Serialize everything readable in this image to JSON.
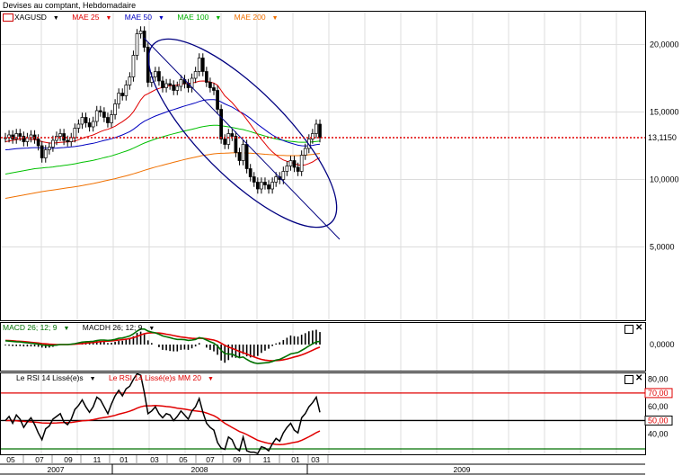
{
  "window": {
    "title": "Devises au comptant, Hebdomadaire"
  },
  "main_legend": {
    "symbol": "XAGUSD",
    "items": [
      {
        "label": "MAE 25",
        "color": "#e00000"
      },
      {
        "label": "MAE 50",
        "color": "#0000c0"
      },
      {
        "label": "MAE 100",
        "color": "#00b000"
      },
      {
        "label": "MAE 200",
        "color": "#f07000"
      }
    ]
  },
  "price_axis": {
    "ticks": [
      "20,0000",
      "15,0000",
      "10,0000",
      "5,0000"
    ],
    "last_price": "13,1150"
  },
  "macd_legend": {
    "items": [
      {
        "label": "MACD 26; 12; 9",
        "color": "#007000"
      },
      {
        "label": "MACDH 26; 12; 9",
        "color": "#000000"
      }
    ]
  },
  "macd_axis": {
    "ticks": [
      "0,0000"
    ]
  },
  "rsi_legend": {
    "items": [
      {
        "label": "Le RSI 14 Lissé(e)s",
        "color": "#000000"
      },
      {
        "label": "Le RSI 14 Lissé(e)s MM 20",
        "color": "#e00000"
      }
    ]
  },
  "rsi_axis": {
    "ticks": [
      "80,00",
      "70,00",
      "60,00",
      "50,00",
      "40,00"
    ]
  },
  "time_axis": {
    "months": [
      "05",
      "07",
      "09",
      "11",
      "01",
      "03",
      "05",
      "07",
      "09",
      "11",
      "01",
      "03"
    ],
    "years": [
      "2007",
      "2008",
      "2009"
    ]
  },
  "chart_data": {
    "type": "candlestick",
    "title": "XAGUSD",
    "ylim": [
      2.5,
      22.5
    ],
    "price_series": {
      "name": "XAGUSD",
      "close": [
        13.1,
        13.3,
        13.0,
        13.4,
        13.2,
        12.8,
        13.1,
        13.3,
        13.0,
        12.5,
        11.6,
        12.2,
        12.4,
        12.9,
        13.2,
        13.4,
        12.9,
        12.8,
        13.1,
        13.8,
        14.1,
        14.6,
        14.2,
        13.9,
        14.3,
        15.1,
        15.0,
        14.6,
        14.2,
        14.8,
        15.6,
        16.4,
        16.2,
        17.0,
        17.6,
        19.2,
        20.8,
        21.0,
        19.8,
        17.2,
        17.6,
        18.0,
        17.3,
        16.8,
        17.1,
        17.0,
        16.6,
        16.9,
        17.4,
        17.1,
        16.8,
        17.5,
        18.0,
        19.0,
        18.0,
        17.2,
        16.8,
        16.6,
        15.2,
        13.0,
        12.6,
        13.4,
        13.2,
        12.0,
        11.4,
        12.6,
        10.8,
        10.2,
        9.8,
        9.3,
        9.8,
        9.6,
        9.3,
        9.8,
        10.2,
        10.0,
        10.6,
        11.0,
        11.4,
        10.9,
        10.6,
        11.8,
        12.3,
        13.0,
        13.4,
        14.1,
        13.1
      ],
      "ma25": [
        12.8,
        12.85,
        12.9,
        12.95,
        13.0,
        13.0,
        12.98,
        12.97,
        12.95,
        12.9,
        12.8,
        12.75,
        12.7,
        12.7,
        12.72,
        12.75,
        12.77,
        12.78,
        12.8,
        12.85,
        12.95,
        13.05,
        13.15,
        13.22,
        13.3,
        13.42,
        13.55,
        13.65,
        13.72,
        13.82,
        13.95,
        14.12,
        14.28,
        14.48,
        14.7,
        15.02,
        15.45,
        15.9,
        16.22,
        16.35,
        16.5,
        16.65,
        16.75,
        16.82,
        16.9,
        16.95,
        16.97,
        17.0,
        17.05,
        17.1,
        17.12,
        17.15,
        17.2,
        17.28,
        17.3,
        17.28,
        17.22,
        17.15,
        16.98,
        16.6,
        16.2,
        15.95,
        15.7,
        15.38,
        15.05,
        14.8,
        14.45,
        14.08,
        13.7,
        13.32,
        12.98,
        12.65,
        12.32,
        12.05,
        11.82,
        11.6,
        11.45,
        11.35,
        11.28,
        11.18,
        11.08,
        11.05,
        11.08,
        11.18,
        11.3,
        11.48,
        11.6
      ],
      "ma50": [
        12.2,
        12.22,
        12.25,
        12.28,
        12.3,
        12.32,
        12.33,
        12.35,
        12.36,
        12.36,
        12.34,
        12.33,
        12.32,
        12.32,
        12.33,
        12.35,
        12.37,
        12.39,
        12.41,
        12.44,
        12.48,
        12.53,
        12.58,
        12.63,
        12.68,
        12.75,
        12.82,
        12.89,
        12.95,
        13.02,
        13.1,
        13.2,
        13.3,
        13.42,
        13.55,
        13.72,
        13.92,
        14.14,
        14.32,
        14.45,
        14.58,
        14.7,
        14.8,
        14.9,
        15.0,
        15.1,
        15.18,
        15.27,
        15.36,
        15.45,
        15.52,
        15.6,
        15.68,
        15.78,
        15.86,
        15.9,
        15.92,
        15.92,
        15.88,
        15.75,
        15.6,
        15.48,
        15.36,
        15.2,
        15.03,
        14.9,
        14.72,
        14.52,
        14.3,
        14.08,
        13.88,
        13.68,
        13.48,
        13.3,
        13.15,
        13.0,
        12.88,
        12.78,
        12.7,
        12.62,
        12.54,
        12.5,
        12.48,
        12.5,
        12.53,
        12.58,
        12.62
      ],
      "ma100": [
        10.4,
        10.45,
        10.5,
        10.55,
        10.6,
        10.65,
        10.7,
        10.75,
        10.8,
        10.83,
        10.85,
        10.88,
        10.9,
        10.93,
        10.97,
        11.0,
        11.04,
        11.07,
        11.11,
        11.16,
        11.21,
        11.27,
        11.32,
        11.37,
        11.42,
        11.48,
        11.55,
        11.62,
        11.68,
        11.75,
        11.83,
        11.92,
        12.01,
        12.1,
        12.2,
        12.32,
        12.45,
        12.58,
        12.7,
        12.8,
        12.9,
        13.0,
        13.08,
        13.16,
        13.24,
        13.32,
        13.39,
        13.46,
        13.53,
        13.6,
        13.66,
        13.72,
        13.78,
        13.86,
        13.92,
        13.96,
        14.0,
        14.02,
        14.02,
        13.98,
        13.94,
        13.9,
        13.86,
        13.8,
        13.74,
        13.7,
        13.62,
        13.55,
        13.46,
        13.38,
        13.3,
        13.22,
        13.14,
        13.07,
        13.01,
        12.95,
        12.9,
        12.86,
        12.83,
        12.8,
        12.77,
        12.76,
        12.76,
        12.77,
        12.79,
        12.82,
        12.84
      ],
      "ma200": [
        8.6,
        8.65,
        8.7,
        8.75,
        8.8,
        8.85,
        8.9,
        8.95,
        9.0,
        9.05,
        9.1,
        9.14,
        9.18,
        9.22,
        9.26,
        9.3,
        9.34,
        9.38,
        9.42,
        9.46,
        9.5,
        9.55,
        9.6,
        9.65,
        9.7,
        9.76,
        9.82,
        9.88,
        9.94,
        10.0,
        10.06,
        10.13,
        10.2,
        10.27,
        10.34,
        10.42,
        10.5,
        10.59,
        10.68,
        10.76,
        10.84,
        10.92,
        10.99,
        11.06,
        11.13,
        11.2,
        11.27,
        11.34,
        11.41,
        11.48,
        11.54,
        11.6,
        11.66,
        11.72,
        11.78,
        11.82,
        11.86,
        11.9,
        11.93,
        11.94,
        11.95,
        11.96,
        11.97,
        11.97,
        11.97,
        11.97,
        11.96,
        11.95,
        11.93,
        11.91,
        11.89,
        11.87,
        11.85,
        11.83,
        11.81,
        11.79,
        11.78,
        11.77,
        11.77,
        11.77,
        11.77,
        11.78,
        11.8,
        11.83,
        11.86,
        11.9,
        11.93
      ]
    },
    "macd": {
      "ylim": [
        -1.2,
        1.2
      ],
      "macd": [
        0.22,
        0.2,
        0.18,
        0.16,
        0.15,
        0.12,
        0.1,
        0.08,
        0.06,
        0.03,
        -0.02,
        -0.05,
        -0.06,
        -0.05,
        -0.03,
        0.0,
        0.0,
        0.0,
        0.02,
        0.05,
        0.1,
        0.14,
        0.16,
        0.17,
        0.19,
        0.23,
        0.26,
        0.26,
        0.24,
        0.26,
        0.3,
        0.36,
        0.38,
        0.44,
        0.5,
        0.62,
        0.78,
        0.9,
        0.9,
        0.78,
        0.72,
        0.68,
        0.6,
        0.5,
        0.45,
        0.4,
        0.34,
        0.3,
        0.3,
        0.28,
        0.24,
        0.26,
        0.3,
        0.4,
        0.36,
        0.26,
        0.16,
        0.08,
        -0.08,
        -0.34,
        -0.52,
        -0.55,
        -0.56,
        -0.66,
        -0.76,
        -0.72,
        -0.86,
        -0.98,
        -1.06,
        -1.1,
        -1.08,
        -1.06,
        -1.04,
        -0.98,
        -0.9,
        -0.86,
        -0.76,
        -0.66,
        -0.54,
        -0.5,
        -0.46,
        -0.34,
        -0.22,
        -0.08,
        0.04,
        0.16,
        0.18
      ],
      "signal": [
        0.24,
        0.23,
        0.22,
        0.2,
        0.19,
        0.17,
        0.15,
        0.13,
        0.11,
        0.09,
        0.06,
        0.04,
        0.02,
        0.01,
        0.0,
        0.0,
        0.0,
        0.0,
        0.01,
        0.02,
        0.04,
        0.06,
        0.08,
        0.1,
        0.12,
        0.14,
        0.17,
        0.19,
        0.2,
        0.21,
        0.23,
        0.26,
        0.28,
        0.31,
        0.35,
        0.4,
        0.47,
        0.56,
        0.63,
        0.67,
        0.68,
        0.68,
        0.67,
        0.64,
        0.6,
        0.57,
        0.52,
        0.48,
        0.44,
        0.41,
        0.38,
        0.36,
        0.35,
        0.36,
        0.36,
        0.34,
        0.3,
        0.26,
        0.19,
        0.08,
        -0.04,
        -0.14,
        -0.22,
        -0.31,
        -0.4,
        -0.47,
        -0.55,
        -0.64,
        -0.72,
        -0.8,
        -0.86,
        -0.9,
        -0.93,
        -0.94,
        -0.93,
        -0.92,
        -0.88,
        -0.84,
        -0.78,
        -0.72,
        -0.67,
        -0.6,
        -0.52,
        -0.43,
        -0.33,
        -0.23,
        -0.15
      ]
    },
    "rsi": {
      "ylim": [
        30,
        85
      ],
      "rsi": [
        50,
        53,
        48,
        54,
        51,
        45,
        49,
        52,
        47,
        41,
        36,
        44,
        46,
        51,
        53,
        55,
        49,
        47,
        51,
        58,
        61,
        65,
        60,
        56,
        60,
        67,
        65,
        60,
        55,
        62,
        68,
        72,
        68,
        73,
        75,
        80,
        84,
        83,
        70,
        55,
        57,
        60,
        55,
        52,
        55,
        54,
        50,
        53,
        57,
        54,
        51,
        57,
        60,
        66,
        56,
        48,
        45,
        43,
        34,
        30,
        29,
        38,
        36,
        30,
        28,
        38,
        28,
        27,
        27,
        26,
        31,
        30,
        28,
        33,
        37,
        35,
        41,
        45,
        48,
        43,
        41,
        52,
        55,
        60,
        63,
        67,
        56
      ],
      "rsi_ma20": [
        50,
        50,
        50,
        49.8,
        49.6,
        49.4,
        49.2,
        49,
        48.8,
        48.6,
        48.3,
        48.2,
        48.1,
        48.2,
        48.3,
        48.4,
        48.5,
        48.5,
        48.6,
        49,
        49.4,
        49.8,
        50,
        50.2,
        50.6,
        51.2,
        51.8,
        52.2,
        52.6,
        53.2,
        53.8,
        54.6,
        55.3,
        56,
        56.8,
        57.8,
        59,
        60,
        60.6,
        60.7,
        60.8,
        61,
        60.8,
        60.5,
        60.2,
        60,
        59.5,
        59,
        58.7,
        58.3,
        57.8,
        57.4,
        57,
        56.7,
        56.3,
        55.5,
        54.5,
        53.5,
        52,
        50,
        48,
        46.5,
        45,
        43.5,
        42,
        41,
        39.8,
        38.4,
        37,
        35.6,
        34.8,
        34,
        33.4,
        33,
        32.6,
        32.4,
        32.6,
        33,
        33.6,
        34.1,
        34.6,
        35.6,
        36.8,
        38.2,
        39.6,
        41.2,
        42.4
      ],
      "levels": [
        70,
        50
      ]
    },
    "annotations": [
      {
        "type": "ellipse"
      },
      {
        "type": "line"
      }
    ]
  }
}
